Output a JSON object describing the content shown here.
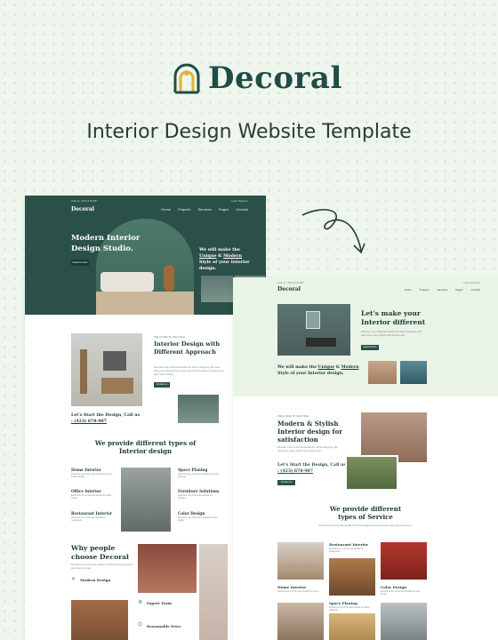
{
  "brand": {
    "name": "Decoral",
    "accent": "#1f4d45",
    "gold": "#e0b23a"
  },
  "headline": "Interior Design Website Template",
  "page1": {
    "topbar_left": "Call us: (423) 678-987",
    "topbar_right": "Login  Register",
    "logo": "Decoral",
    "menu": [
      "Home",
      "Projects",
      "Services",
      "Pages",
      "Contact"
    ],
    "hero_title": "Modern Interior Design Studio.",
    "hero_button": "Explore Now",
    "hero_tag_pre": "We will make the ",
    "hero_tag_u1": "Unique",
    "hero_tag_mid": " & ",
    "hero_tag_u2": "Modern",
    "hero_tag_post": " Style of your Interior design.",
    "about_kicker": "WELCOME TO DECORAL",
    "about_title": "Interior Design with Different Approach",
    "about_text": "Decoral is one of the best studios for interior designing. We have done more projects than anyone else and it is always counted as the best interior design.",
    "about_button": "Contact us",
    "call_line1": "Let's Start the Design, Call us",
    "call_line2": ": (423) 678-987",
    "services_title": "We provide different types of Interior design",
    "services": [
      {
        "name": "Home Interior",
        "desc": "Decoral is one of the best studios for home interior design."
      },
      {
        "name": "Space Planing",
        "desc": "Decoral is one of the best studios for space planning."
      },
      {
        "name": "Office Interior",
        "desc": "Decoral is one of the best studios for office interior."
      },
      {
        "name": "Furniture Solutions",
        "desc": "Decoral is one of the best studios for furniture."
      },
      {
        "name": "Restaurant Interior",
        "desc": "Decoral is one of the best studios for restaurants."
      },
      {
        "name": "Color Design",
        "desc": "Decoral is one of the best studios for color design."
      }
    ],
    "why_title": "Why people choose Decoral",
    "why_text": "Decoral is one of the best studios for interior designing and we are trusted by many.",
    "features": [
      "Modern Design",
      "Expert Team",
      "Reasonable Price"
    ]
  },
  "page2": {
    "topbar_left": "Call us: (423) 678-987",
    "topbar_right": "Login  Register",
    "logo": "Decoral",
    "menu": [
      "Home",
      "Projects",
      "Services",
      "Pages",
      "Contact"
    ],
    "hero_title": "Let's make your Interior different",
    "hero_text": "Decoral is one of the best studios for interior designing. We have done more projects than anyone else.",
    "hero_button": "Explore Now",
    "tag_pre": "We will make the ",
    "tag_u1": "Unique",
    "tag_mid": " & ",
    "tag_u2": "Modern",
    "tag_post": " Style of your Interior design.",
    "kicker": "WELCOME TO DECORAL",
    "about_title": "Modern & Stylish Interior design for satisfaction",
    "about_text": "Decoral is one of the best studios for interior designing. We have done more projects than anyone else.",
    "call_line1": "Let's Start the Design, Call us",
    "call_line2": ": (423) 678-987",
    "about_button": "Contact us",
    "services_title": "We provide different types of Service",
    "services_text": "Decoral is one of the best studios for interior designing and we provide many types of services.",
    "services": [
      {
        "name": "Restaurant Interior",
        "desc": "Decoral is one of the best studios for restaurants."
      },
      {
        "name": "Home Interior",
        "desc": "Decoral is one of the best studios for homes."
      },
      {
        "name": "Color Design",
        "desc": "Decoral is one of the best studios for color design."
      },
      {
        "name": "Space Planing",
        "desc": "Decoral is one of the best studios for space planning."
      }
    ]
  }
}
